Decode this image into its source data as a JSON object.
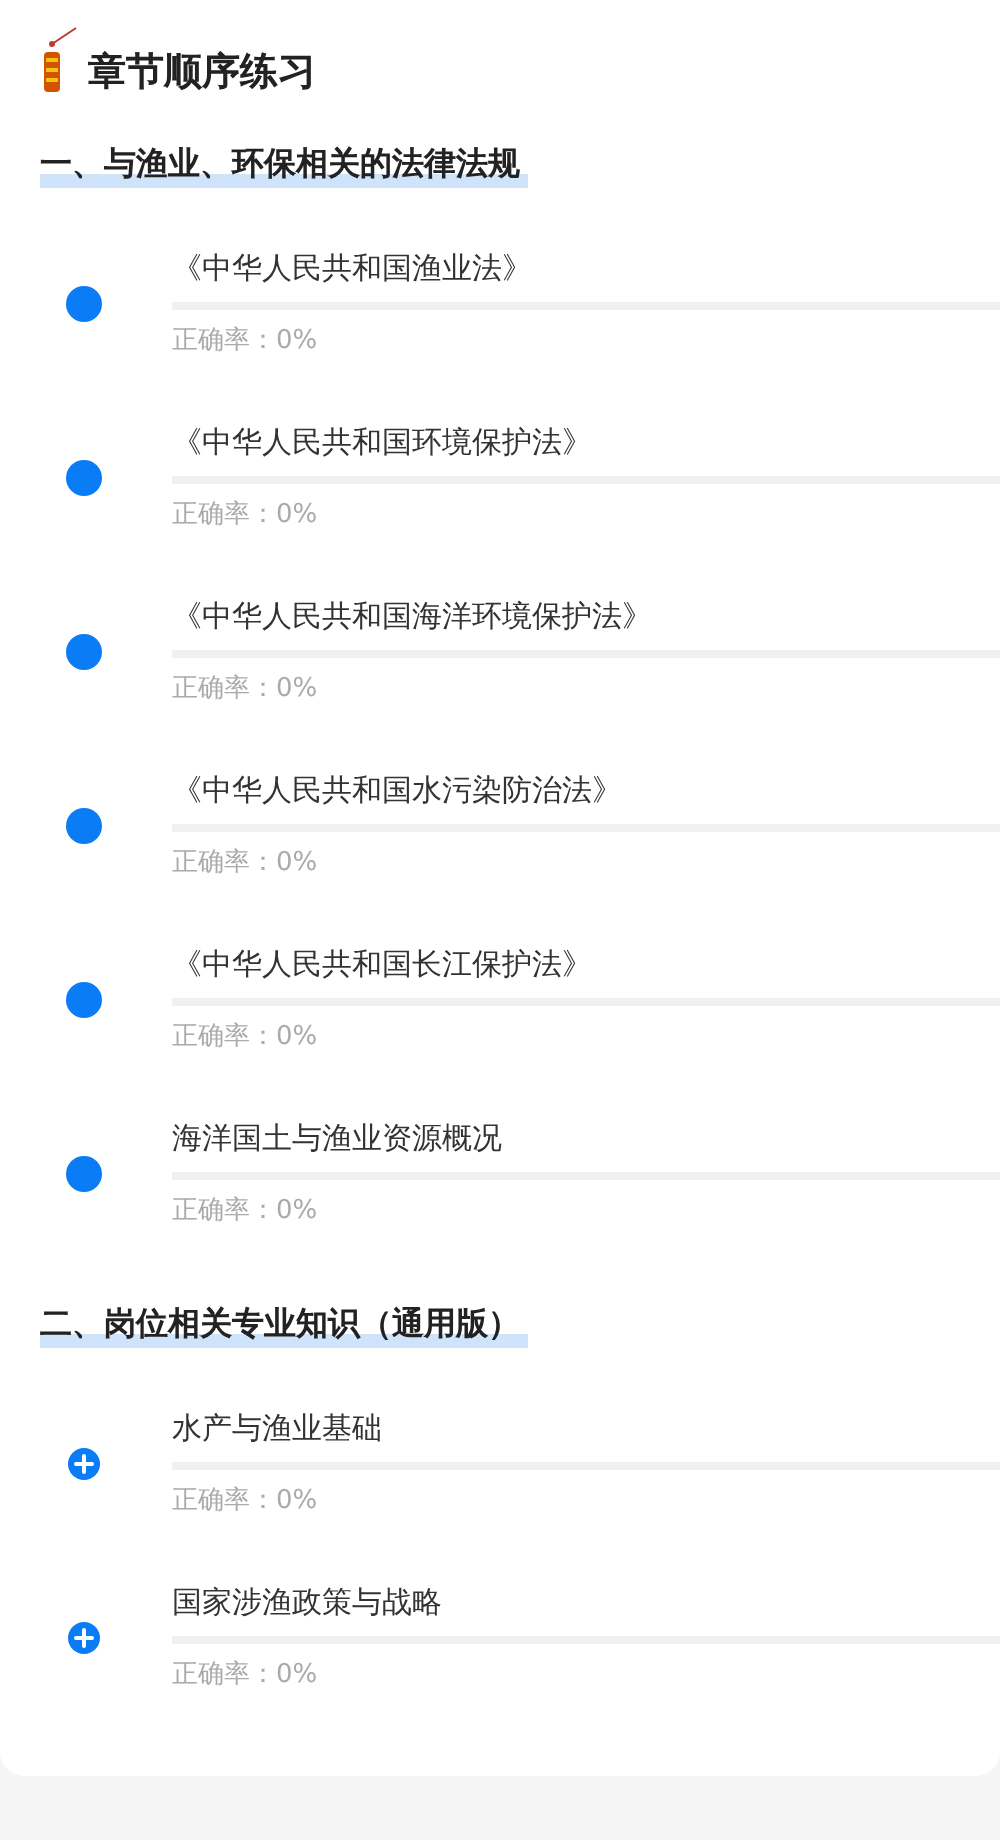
{
  "title": "章节顺序练习",
  "sections": [
    {
      "heading": "一、与渔业、环保相关的法律法规",
      "items": [
        {
          "kind": "dot",
          "name": "《中华人民共和国渔业法》",
          "level": 0,
          "accuracy": "正确率：0%"
        },
        {
          "kind": "dot",
          "name": "《中华人民共和国环境保护法》",
          "level": 0,
          "accuracy": "正确率：0%"
        },
        {
          "kind": "dot",
          "name": "《中华人民共和国海洋环境保护法》",
          "level": 0,
          "accuracy": "正确率：0%"
        },
        {
          "kind": "dot",
          "name": "《中华人民共和国水污染防治法》",
          "level": 0,
          "accuracy": "正确率：0%"
        },
        {
          "kind": "dot",
          "name": "《中华人民共和国长江保护法》",
          "level": 0,
          "accuracy": "正确率：0%"
        },
        {
          "kind": "dot",
          "name": "海洋国土与渔业资源概况",
          "level": 0,
          "accuracy": "正确率：0%"
        }
      ]
    },
    {
      "heading": "二、岗位相关专业知识（通用版）",
      "items": [
        {
          "kind": "plus",
          "name": "水产与渔业基础",
          "level": 0,
          "accuracy": "正确率：0%"
        },
        {
          "kind": "plus",
          "name": "国家涉渔政策与战略",
          "level": 0,
          "accuracy": "正确率：0%"
        }
      ]
    }
  ]
}
